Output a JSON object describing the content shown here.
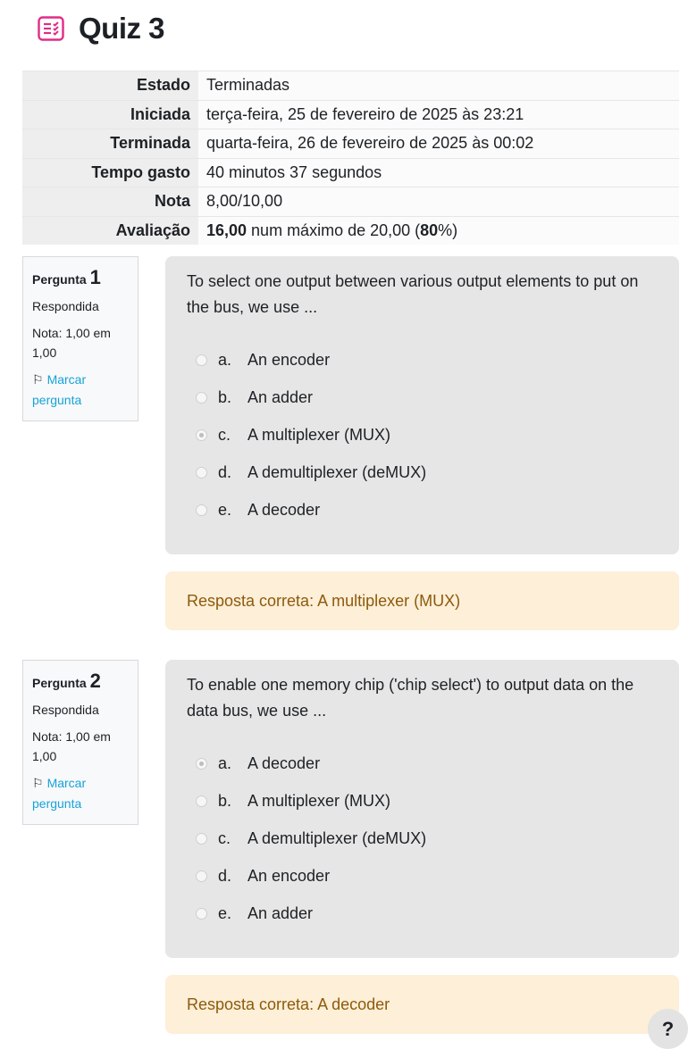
{
  "page": {
    "title": "Quiz 3",
    "icon": "quiz-icon"
  },
  "summary": [
    {
      "label": "Estado",
      "value": "Terminadas"
    },
    {
      "label": "Iniciada",
      "value": "terça-feira, 25 de fevereiro de 2025 às 23:21"
    },
    {
      "label": "Terminada",
      "value": "quarta-feira, 26 de fevereiro de 2025 às 00:02"
    },
    {
      "label": "Tempo gasto",
      "value": "40 minutos 37 segundos"
    },
    {
      "label": "Nota",
      "value": "8,00/10,00"
    },
    {
      "label": "Avaliação",
      "value_bold1": "16,00",
      "value_mid": " num máximo de 20,00 (",
      "value_bold2": "80",
      "value_end": "%)"
    }
  ],
  "questions": [
    {
      "label": "Pergunta",
      "number": "1",
      "status": "Respondida",
      "grade": "Nota: 1,00 em 1,00",
      "flag_label": "Marcar pergunta",
      "text": "To select one output between various output elements to put on the bus, we use ...",
      "answers": [
        {
          "letter": "a.",
          "text": "An encoder",
          "selected": false
        },
        {
          "letter": "b.",
          "text": "An adder",
          "selected": false
        },
        {
          "letter": "c.",
          "text": "A multiplexer (MUX)",
          "selected": true
        },
        {
          "letter": "d.",
          "text": "A demultiplexer (deMUX)",
          "selected": false
        },
        {
          "letter": "e.",
          "text": "A decoder",
          "selected": false
        }
      ],
      "feedback": "Resposta correta: A multiplexer (MUX)"
    },
    {
      "label": "Pergunta",
      "number": "2",
      "status": "Respondida",
      "grade": "Nota: 1,00 em 1,00",
      "flag_label": "Marcar pergunta",
      "text": "To enable one memory chip ('chip select') to output data on the data bus, we use ...",
      "answers": [
        {
          "letter": "a.",
          "text": "A decoder",
          "selected": true
        },
        {
          "letter": "b.",
          "text": "A multiplexer (MUX)",
          "selected": false
        },
        {
          "letter": "c.",
          "text": "A demultiplexer (deMUX)",
          "selected": false
        },
        {
          "letter": "d.",
          "text": "An encoder",
          "selected": false
        },
        {
          "letter": "e.",
          "text": "An adder",
          "selected": false
        }
      ],
      "feedback": "Resposta correta: A decoder"
    }
  ],
  "help": {
    "label": "?"
  },
  "colors": {
    "accent_icon": "#e22b87",
    "link": "#17a2d8",
    "feedback_text": "#8e5a0b",
    "feedback_bg": "#fdefd8"
  }
}
